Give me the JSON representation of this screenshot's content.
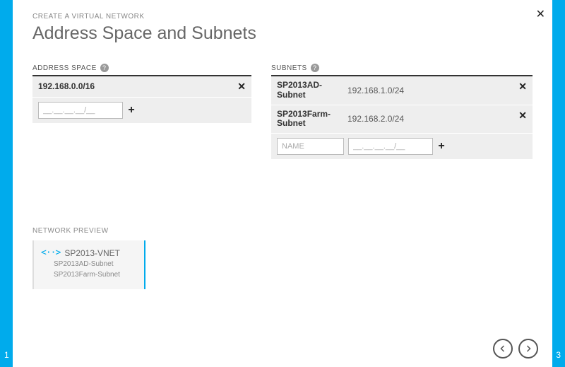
{
  "step_left": "1",
  "step_right": "3",
  "eyebrow": "CREATE A VIRTUAL NETWORK",
  "title": "Address Space and Subnets",
  "address_space": {
    "label": "ADDRESS SPACE",
    "items": [
      {
        "cidr": "192.168.0.0/16"
      }
    ],
    "input_placeholder": "__.__.__.__/__"
  },
  "subnets": {
    "label": "SUBNETS",
    "items": [
      {
        "name": "SP2013AD-Subnet",
        "cidr": "192.168.1.0/24"
      },
      {
        "name": "SP2013Farm-Subnet",
        "cidr": "192.168.2.0/24"
      }
    ],
    "name_placeholder": "NAME",
    "cidr_placeholder": "__.__.__.__/__"
  },
  "preview": {
    "label": "NETWORK PREVIEW",
    "vnet": "SP2013-VNET",
    "subnets": [
      "SP2013AD-Subnet",
      "SP2013Farm-Subnet"
    ]
  }
}
